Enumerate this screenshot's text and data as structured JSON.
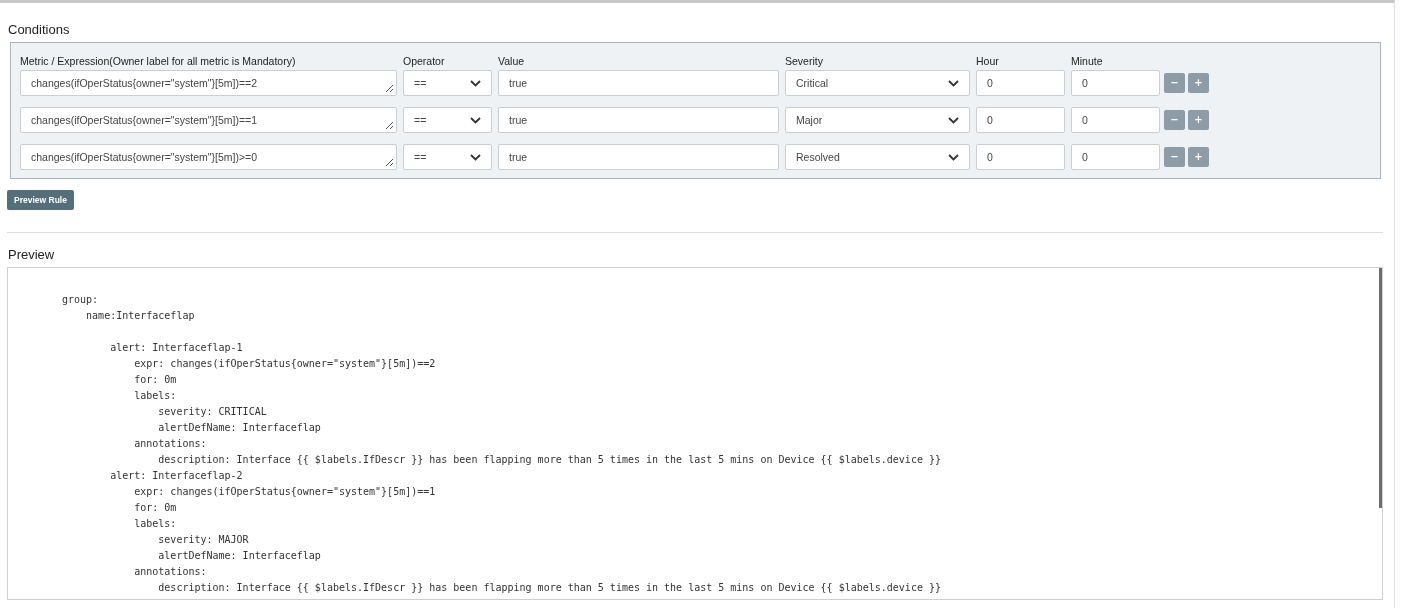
{
  "conditions": {
    "title": "Conditions",
    "columns": [
      "Metric / Expression(Owner label for all metric is Mandatory)",
      "Operator",
      "Value",
      "Severity",
      "Hour",
      "Minute"
    ],
    "rows": [
      {
        "expression": "changes(ifOperStatus{owner=\"system\"}[5m])==2",
        "operator": "==",
        "value": "true",
        "severity": "Critical",
        "hour": "0",
        "minute": "0"
      },
      {
        "expression": "changes(ifOperStatus{owner=\"system\"}[5m])==1",
        "operator": "==",
        "value": "true",
        "severity": "Major",
        "hour": "0",
        "minute": "0"
      },
      {
        "expression": "changes(ifOperStatus{owner=\"system\"}[5m])>=0",
        "operator": "==",
        "value": "true",
        "severity": "Resolved",
        "hour": "0",
        "minute": "0"
      }
    ],
    "remove_label": "−",
    "add_label": "+",
    "preview_button": "Preview Rule"
  },
  "preview": {
    "title": "Preview",
    "blocks": [
      [
        "group:",
        "    name:Interfaceflap"
      ],
      [
        "        alert: Interfaceflap-1",
        "            expr: changes(ifOperStatus{owner=\"system\"}[5m])==2",
        "            for: 0m",
        "            labels:",
        "                severity: CRITICAL",
        "                alertDefName: Interfaceflap",
        "            annotations:",
        "                description: Interface {{ $labels.IfDescr }} has been flapping more than 5 times in the last 5 mins on Device {{ $labels.device }}",
        "        alert: Interfaceflap-2",
        "            expr: changes(ifOperStatus{owner=\"system\"}[5m])==1",
        "            for: 0m",
        "            labels:",
        "                severity: MAJOR",
        "                alertDefName: Interfaceflap",
        "            annotations:",
        "                description: Interface {{ $labels.IfDescr }} has been flapping more than 5 times in the last 5 mins on Device {{ $labels.device }}"
      ]
    ]
  }
}
